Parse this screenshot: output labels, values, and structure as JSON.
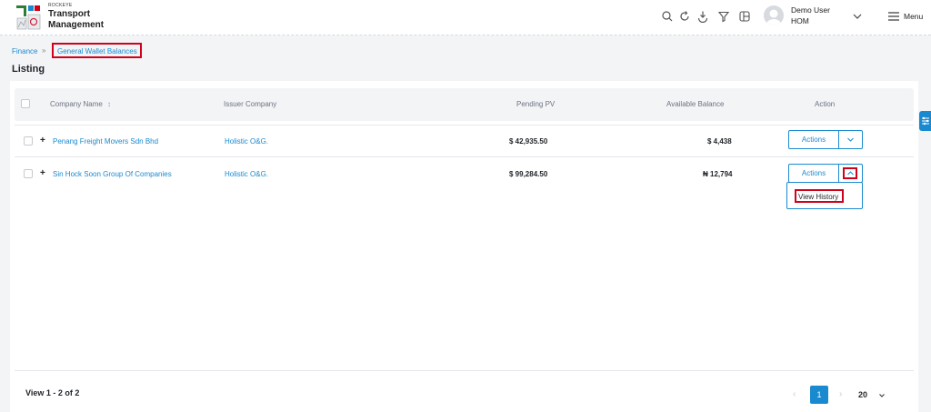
{
  "header": {
    "brand_small": "ROCKEYE",
    "brand_line1": "Transport",
    "brand_line2": "Management",
    "icons": [
      "search-icon",
      "refresh-icon",
      "download-icon",
      "filter-icon",
      "layout-icon"
    ],
    "user": {
      "name": "Demo User",
      "role": "HOM"
    },
    "menu_label": "Menu"
  },
  "breadcrumb": {
    "parent": "Finance",
    "separator": "»",
    "current": "General Wallet Balances"
  },
  "page": {
    "title": "Listing"
  },
  "table": {
    "columns": {
      "company_name": "Company Name",
      "sort_icon": "↕",
      "issuer_company": "Issuer Company",
      "pending_pv": "Pending PV",
      "available_balance": "Available Balance",
      "action": "Action"
    },
    "rows": [
      {
        "company_name": "Penang Freight Movers Sdn Bhd",
        "issuer_company": "Holistic O&G.",
        "pending_pv": "$ 42,935.50",
        "available_balance": "$ 4,438",
        "action_label": "Actions"
      },
      {
        "company_name": "Sin Hock Soon Group Of Companies",
        "issuer_company": "Holistic O&G.",
        "pending_pv": "$ 99,284.50",
        "available_balance": "₦ 12,794",
        "action_label": "Actions"
      }
    ],
    "expand_symbol": "+"
  },
  "dropdown": {
    "items": [
      "View History"
    ]
  },
  "pagination": {
    "view_text": "View 1 - 2 of 2",
    "prev": "‹",
    "current_page": "1",
    "next": "›",
    "page_size": "20"
  },
  "colors": {
    "accent": "#1a8ad0",
    "highlight": "#d0021b"
  }
}
